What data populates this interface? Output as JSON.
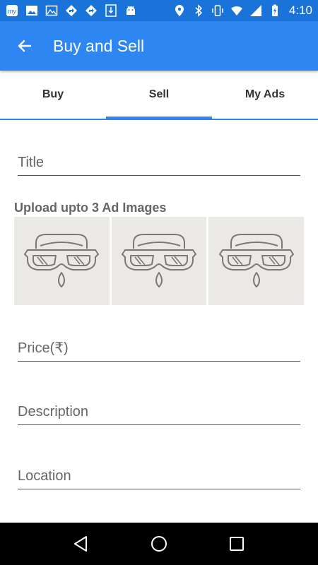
{
  "status_bar": {
    "time": "4:10",
    "left_icons": [
      "my-app-icon",
      "image-icon",
      "photo-icon",
      "location-diamond-icon",
      "location-diamond-icon",
      "download-icon",
      "android-icon"
    ],
    "right_icons": [
      "location-pin-icon",
      "bluetooth-icon",
      "vibrate-icon",
      "wifi-icon",
      "signal-icon",
      "battery-charging-icon"
    ]
  },
  "app_bar": {
    "title": "Buy and Sell"
  },
  "tabs": [
    {
      "label": "Buy",
      "active": false
    },
    {
      "label": "Sell",
      "active": true
    },
    {
      "label": "My Ads",
      "active": false
    }
  ],
  "form": {
    "title_placeholder": "Title",
    "upload_label": "Upload upto 3 Ad Images",
    "image_slots": [
      "mask-placeholder-icon",
      "mask-placeholder-icon",
      "mask-placeholder-icon"
    ],
    "price_placeholder": "Price(₹)",
    "description_placeholder": "Description",
    "location_placeholder": "Location"
  },
  "colors": {
    "status_bar": "#1a73d9",
    "primary": "#2d86f1",
    "image_slot_bg": "#ebe9e5",
    "nav_bar": "#000000"
  }
}
